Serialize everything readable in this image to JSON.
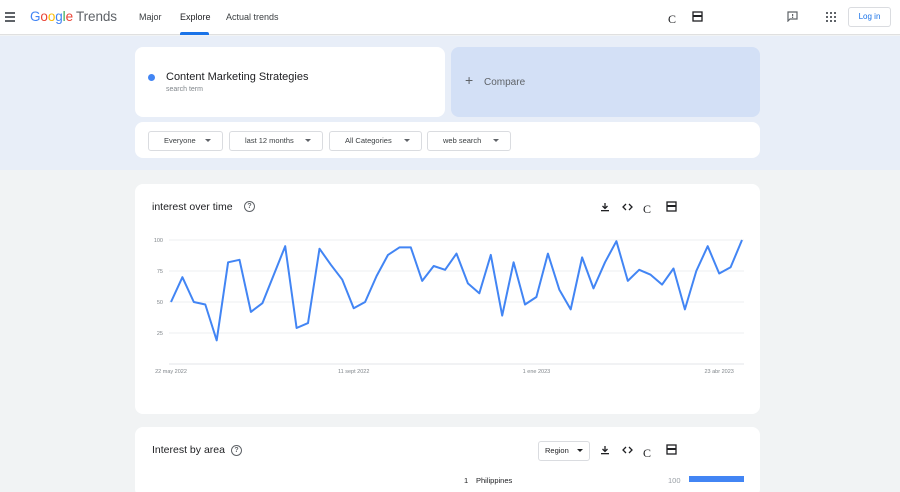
{
  "header": {
    "logo": {
      "g1": "G",
      "g2": "o",
      "g3": "o",
      "g4": "g",
      "g5": "l",
      "g6": "e",
      "product": "Trends"
    },
    "nav": [
      "Major",
      "Explore",
      "Actual trends"
    ],
    "active_nav": "Explore",
    "icons": [
      "refresh-c-icon",
      "embed-card-icon",
      "feedback-icon",
      "apps-grid-icon"
    ],
    "refresh_glyph": "C",
    "login_label": "Log in"
  },
  "search": {
    "term": "Content Marketing Strategies",
    "term_type": "search term",
    "term_color": "#4285f4",
    "compare_plus": "+",
    "compare_label": "Compare"
  },
  "filters": [
    "Everyone",
    "last 12 months",
    "All Categories",
    "web search"
  ],
  "interest_over_time": {
    "title": "interest over time",
    "help_glyph": "?",
    "refresh_glyph": "C"
  },
  "chart_data": {
    "type": "line",
    "title": "",
    "xlabel": "",
    "ylabel": "",
    "ylim": [
      0,
      100
    ],
    "yticks": [
      25,
      50,
      75,
      100
    ],
    "grid": true,
    "x_tick_labels": [
      "22 may 2022",
      "11 sept 2022",
      "1 ene 2023",
      "23 abr 2023"
    ],
    "x_tick_index": [
      0,
      16,
      32,
      48
    ],
    "series": [
      {
        "color": "#4285f4",
        "values": [
          50,
          70,
          50,
          48,
          19,
          82,
          84,
          42,
          49,
          72,
          95,
          29,
          33,
          93,
          80,
          68,
          45,
          50,
          71,
          88,
          94,
          94,
          67,
          79,
          76,
          89,
          65,
          57,
          88,
          39,
          82,
          48,
          54,
          89,
          60,
          44,
          86,
          61,
          82,
          99,
          67,
          76,
          72,
          64,
          77,
          44,
          75,
          95,
          73,
          78,
          100
        ]
      }
    ]
  },
  "interest_by_area": {
    "title": "Interest by area",
    "help_glyph": "?",
    "resolution": "Region",
    "refresh_glyph": "C",
    "rows": [
      {
        "rank": "1",
        "name": "Philippines",
        "value": "100"
      }
    ]
  }
}
